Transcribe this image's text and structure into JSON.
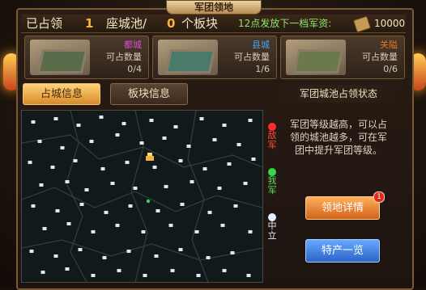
{
  "window": {
    "title": "军团领地"
  },
  "summary": {
    "prefix": "已占领",
    "cities_count": "1",
    "cities_unit": "座城池/",
    "blocks_count": "0",
    "blocks_unit": "个板块",
    "resource_text": "12点发放下一档军资:",
    "resource_value": "10000",
    "resource_icon": "supply-bundle-icon"
  },
  "cities": [
    {
      "name": "都城",
      "name_color": "#e04ad2",
      "label": "可占数量",
      "count": "0/4"
    },
    {
      "name": "县城",
      "name_color": "#4aa0e6",
      "label": "可占数量",
      "count": "1/6"
    },
    {
      "name": "关隘",
      "name_color": "#e07a2a",
      "label": "可占数量",
      "count": "0/6"
    }
  ],
  "tabs": [
    {
      "label": "占城信息",
      "active": true
    },
    {
      "label": "板块信息",
      "active": false
    }
  ],
  "status_title": "军团城池占领状态",
  "legend": [
    {
      "label": "敌军",
      "color": "#ff2a2a"
    },
    {
      "label": "我军",
      "color": "#3ad64a"
    },
    {
      "label": "中立",
      "color": "#e6f2ff"
    }
  ],
  "description": "军团等级越高，可以占领的城池越多，可在军团中提升军团等级。",
  "buttons": {
    "detail": "领地详情",
    "detail_badge": "1",
    "specialty": "特产一览"
  }
}
